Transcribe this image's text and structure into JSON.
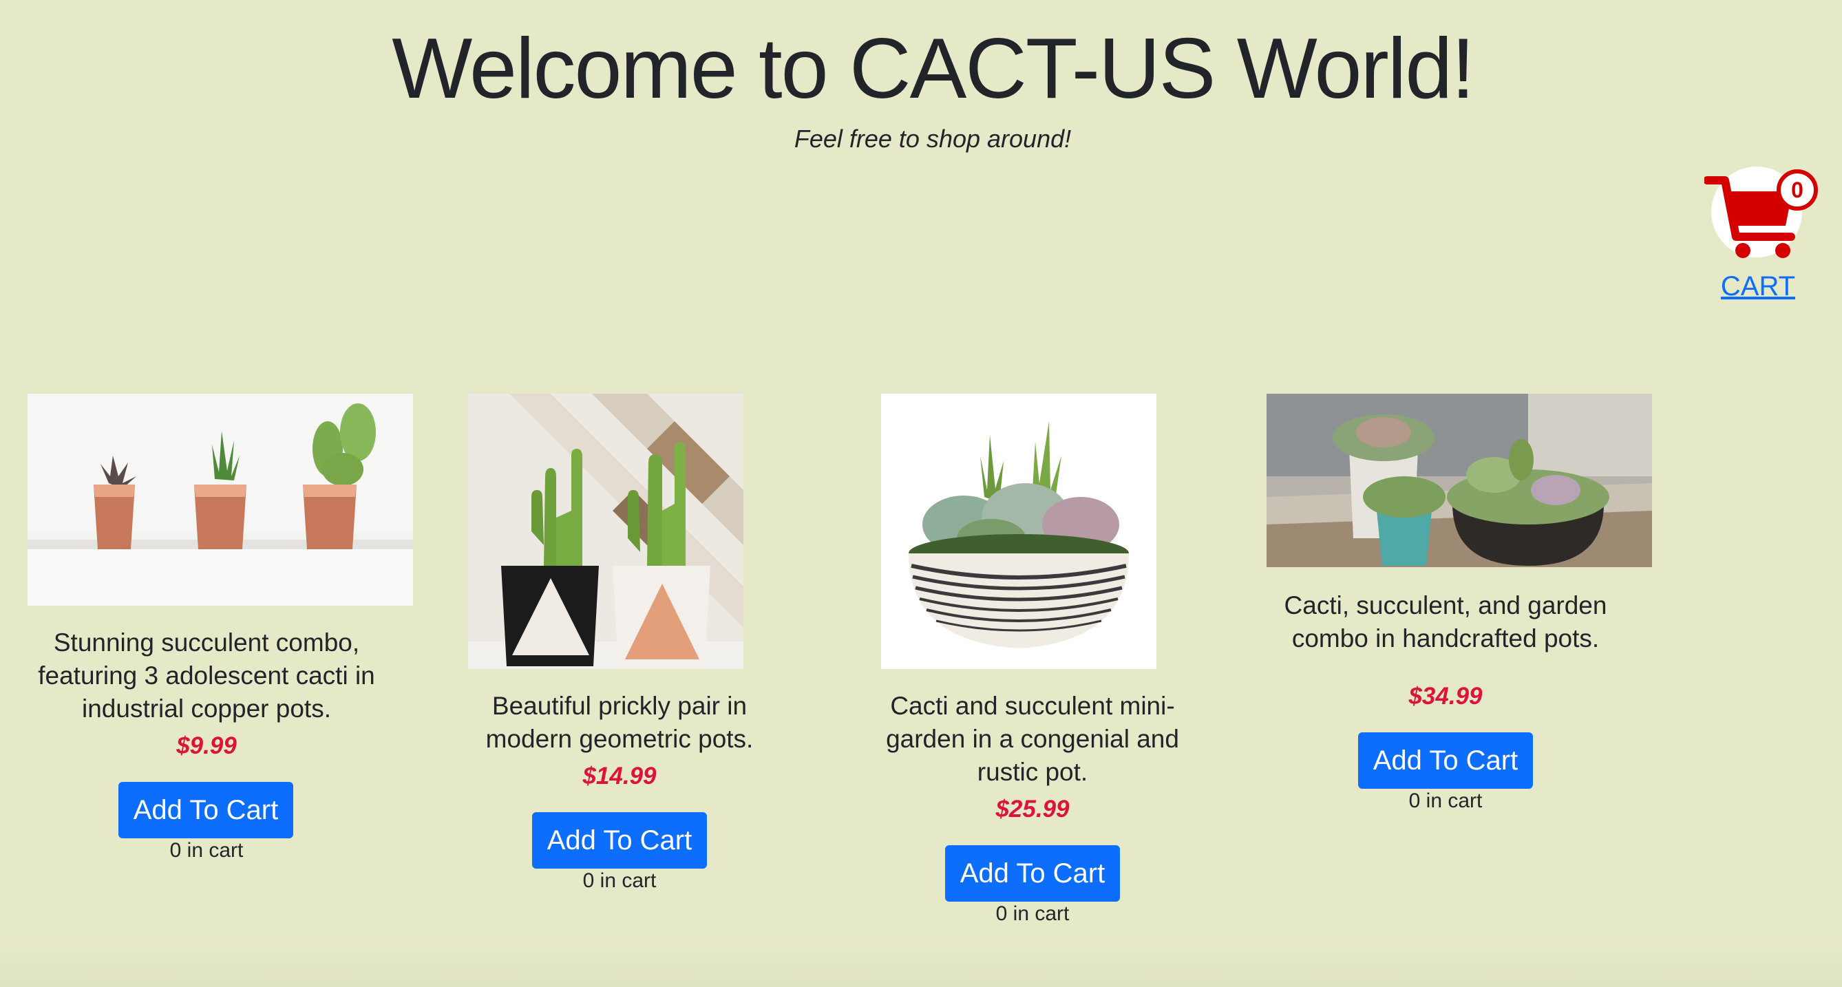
{
  "header": {
    "title": "Welcome to CACT-US World!",
    "subtitle": "Feel free to shop around!"
  },
  "cart": {
    "count": "0",
    "link_label": "CART",
    "icon": "shopping-cart-icon",
    "color": "#d40000"
  },
  "colors": {
    "background": "#e6e9c8",
    "button": "#0d6efd",
    "price": "#dc143c",
    "link": "#0d6efd"
  },
  "products": [
    {
      "description": "Stunning succulent combo, featuring 3 adolescent cacti in industrial copper pots.",
      "price": "$9.99",
      "button_label": "Add To Cart",
      "in_cart": "0 in cart",
      "image": "three cacti in copper pots"
    },
    {
      "description": "Beautiful prickly pair in modern geometric pots.",
      "price": "$14.99",
      "button_label": "Add To Cart",
      "in_cart": "0 in cart",
      "image": "two cacti in geometric pots"
    },
    {
      "description": "Cacti and succulent mini-garden in a congenial and rustic pot.",
      "price": "$25.99",
      "button_label": "Add To Cart",
      "in_cart": "0 in cart",
      "image": "succulent mini-garden in striped bowl"
    },
    {
      "description": "Cacti, succulent, and garden combo in handcrafted pots.",
      "price": "$34.99",
      "button_label": "Add To Cart",
      "in_cart": "0 in cart",
      "image": "succulents in handcrafted pots on table"
    }
  ]
}
